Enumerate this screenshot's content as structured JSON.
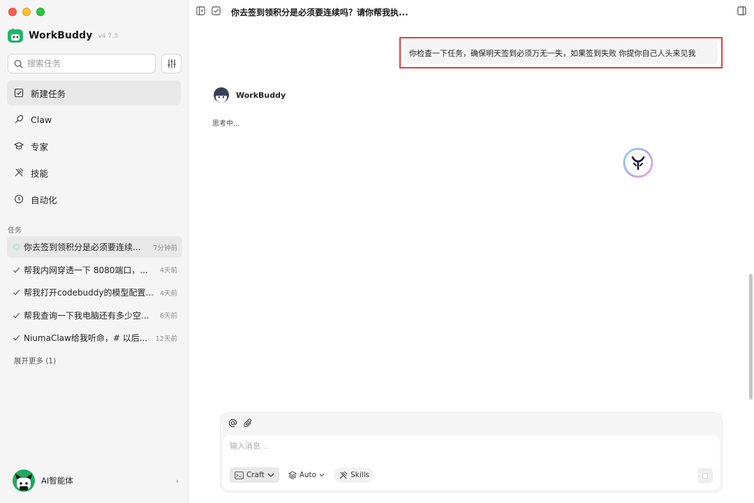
{
  "app": {
    "name": "WorkBuddy",
    "version": "v4.7.3"
  },
  "colors": {
    "accent_green": "#1fb56a",
    "highlight_red": "#e53b3b",
    "sidebar_bg": "#f5f5f5"
  },
  "sidebar": {
    "search_placeholder": "搜索任务",
    "nav": [
      {
        "label": "新建任务",
        "icon": "new-task-icon",
        "active": true
      },
      {
        "label": "Claw",
        "icon": "claw-icon"
      },
      {
        "label": "专家",
        "icon": "graduation-cap-icon"
      },
      {
        "label": "技能",
        "icon": "tools-icon"
      },
      {
        "label": "自动化",
        "icon": "clock-icon"
      }
    ],
    "tasks_label": "任务",
    "tasks": [
      {
        "title": "你去签到领积分是必须要连续...",
        "time": "7分钟前",
        "status": "running"
      },
      {
        "title": "帮我内网穿透一下 8080端口，...",
        "time": "4天前",
        "status": "done"
      },
      {
        "title": "帮我打开codebuddy的模型配置...",
        "time": "4天前",
        "status": "done"
      },
      {
        "title": "帮我查询一下我电脑还有多少空...",
        "time": "6天前",
        "status": "done"
      },
      {
        "title": "NiumaClaw给我听命，# 以后...",
        "time": "12天前",
        "status": "done"
      }
    ],
    "expand_more": "展开更多 (1)",
    "user": {
      "name": "AI智能体"
    }
  },
  "main": {
    "title": "你去签到领积分是必须要连续吗？请你帮我执...",
    "user_message": "你检查一下任务，确保明天签到必须万无一失，如果签到失败 你提你自己人头来见我",
    "assistant_name": "WorkBuddy",
    "thinking_text": "思考中...",
    "composer": {
      "placeholder": "输入消息...",
      "mode_label": "Craft",
      "model_label": "Auto",
      "skills_label": "Skills"
    }
  }
}
